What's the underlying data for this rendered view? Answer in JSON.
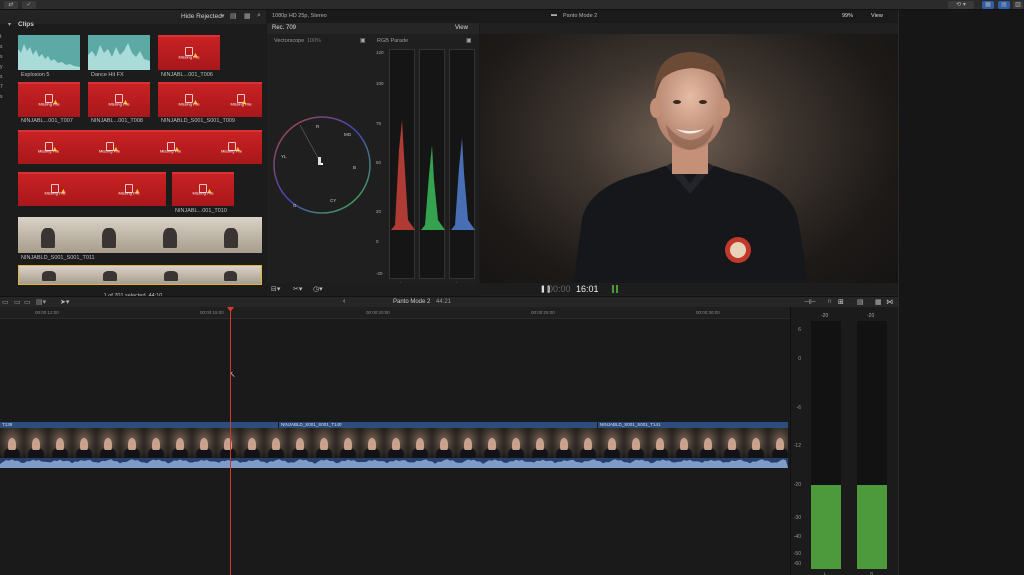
{
  "browser": {
    "filter": "Hide Rejected",
    "section": "Clips",
    "status": "1 of 701 selected, 44:10",
    "clips": [
      {
        "label": "Explosion 5",
        "kind": "audio"
      },
      {
        "label": "Dance Hit FX",
        "kind": "audio"
      },
      {
        "label": "NINJABL...001_T006",
        "kind": "missing"
      },
      {
        "label": "NINJABL...001_T007",
        "kind": "missing"
      },
      {
        "label": "NINJABL...001_T008",
        "kind": "missing"
      },
      {
        "label": "NINJABLD_S001_S001_T009",
        "kind": "missing"
      },
      {
        "label": "NINJABL...001_T010",
        "kind": "missing"
      },
      {
        "label": "NINJABLD_S001_S001_T011",
        "kind": "video"
      }
    ],
    "missing_text": "Missing File"
  },
  "scopes": {
    "title": "Rec. 709",
    "view_label": "View",
    "vectorscope_label": "Vectorscope",
    "vectorscope_pct": "100%",
    "parade_label": "RGB Parade",
    "parade_scale": [
      "120",
      "100",
      "75",
      "50",
      "20",
      "0",
      "-20"
    ],
    "channels": [
      "Red",
      "Green",
      "Blue"
    ],
    "vector_targets": [
      "R",
      "MG",
      "B",
      "CY",
      "G",
      "YL"
    ]
  },
  "viewer": {
    "format": "1080p HD 25p, Stereo",
    "project": "Panto Mode 2",
    "zoom": "99%",
    "view_label": "View",
    "timecode_dim": "00:00",
    "timecode": "16:01"
  },
  "timeline": {
    "project": "Panto Mode 2",
    "duration": "44:21",
    "ruler": [
      "00:00:12:00",
      "00:00:15:00",
      "00:00:20:00",
      "00:00:25:00",
      "00:00:30:00"
    ],
    "clips": [
      {
        "label": "T139"
      },
      {
        "label": "NINJABLD_S001_S001_T140"
      },
      {
        "label": "NINJABLD_S001_S001_T141"
      }
    ],
    "playhead_sec": 15.0
  },
  "meters": {
    "peak_left": "-20",
    "peak_right": "-20",
    "scale": [
      "6",
      "0",
      "-6",
      "-12",
      "-20",
      "-30",
      "-40",
      "-50",
      "-60"
    ],
    "level_db": -20,
    "channels": [
      "L",
      "R"
    ]
  },
  "colors": {
    "accent": "#2f5ea8",
    "playhead": "#d03a2e",
    "meter": "#4c9a3c",
    "missing": "#c92224"
  }
}
